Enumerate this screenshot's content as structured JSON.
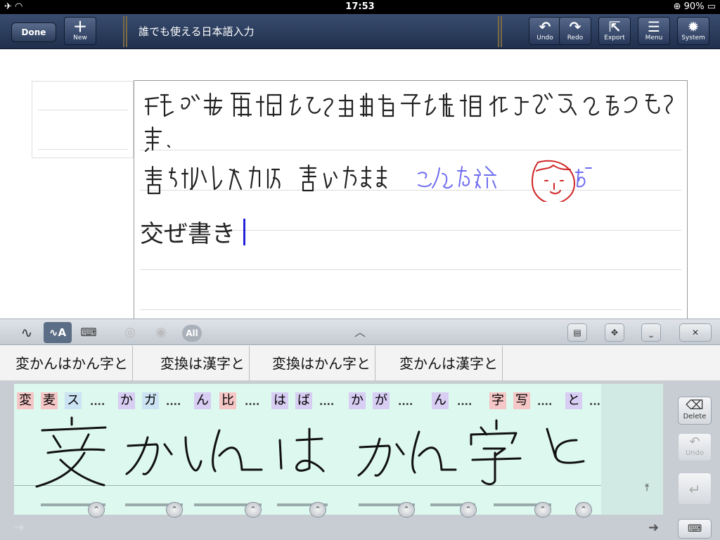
{
  "status_bar": {
    "time": "17:53",
    "battery": "90%"
  },
  "navbar": {
    "done_label": "Done",
    "new_label": "New",
    "title": "誰でも使える日本語入力",
    "buttons": [
      {
        "label": "Undo",
        "icon": "↶"
      },
      {
        "label": "Redo",
        "icon": "↷"
      },
      {
        "label": "Export",
        "icon": "⇱"
      },
      {
        "label": "Menu",
        "icon": "☰"
      },
      {
        "label": "System",
        "icon": "✹"
      }
    ]
  },
  "note": {
    "typed_line": "交ぜ書き"
  },
  "toolbar": {
    "all_label": "All"
  },
  "candidates": [
    "変かんはかん字と",
    "変換は漢字と",
    "変換はかん字と",
    "変かんは漢字と"
  ],
  "pad": {
    "chips": [
      {
        "text": "変",
        "color": "#f5c6c6"
      },
      {
        "text": "麦",
        "color": "#f5c6c6"
      },
      {
        "text": "ス",
        "color": "#cce3f3"
      },
      {
        "text": "か",
        "color": "#d8cdf3"
      },
      {
        "text": "ガ",
        "color": "#cce3f3"
      },
      {
        "text": "ん",
        "color": "#d8cdf3"
      },
      {
        "text": "比",
        "color": "#f5c6c6"
      },
      {
        "text": "は",
        "color": "#d8cdf3"
      },
      {
        "text": "ば",
        "color": "#d8cdf3"
      },
      {
        "text": "か",
        "color": "#d8cdf3"
      },
      {
        "text": "が",
        "color": "#d8cdf3"
      },
      {
        "text": "ん",
        "color": "#d8cdf3"
      },
      {
        "text": "字",
        "color": "#f5c6c6"
      },
      {
        "text": "写",
        "color": "#f5c6c6"
      },
      {
        "text": "と",
        "color": "#d8cdf3"
      }
    ],
    "ellipsis": "...."
  },
  "side": {
    "delete_label": "Delete",
    "undo_label": "Undo"
  }
}
